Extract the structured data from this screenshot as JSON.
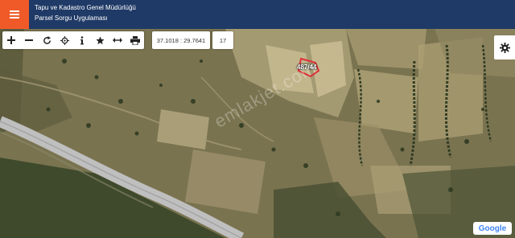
{
  "header": {
    "title_line1": "Tapu ve Kadastro Genel Müdürlüğü",
    "title_line2": "Parsel Sorgu Uygulaması"
  },
  "toolbar": {
    "tools": [
      "zoom-in-icon",
      "zoom-out-icon",
      "refresh-icon",
      "locate-icon",
      "info-icon",
      "star-icon",
      "measure-icon",
      "print-icon"
    ],
    "coordinates": "37.1018 : 29.7641",
    "zoom_level": "17"
  },
  "map": {
    "parcel_label": "487/44",
    "watermark": "emlakjet.com",
    "attribution": "Google"
  },
  "colors": {
    "header_bg": "#1f3a66",
    "menu_accent": "#f05a28",
    "parcel_outline": "#e0303a"
  }
}
